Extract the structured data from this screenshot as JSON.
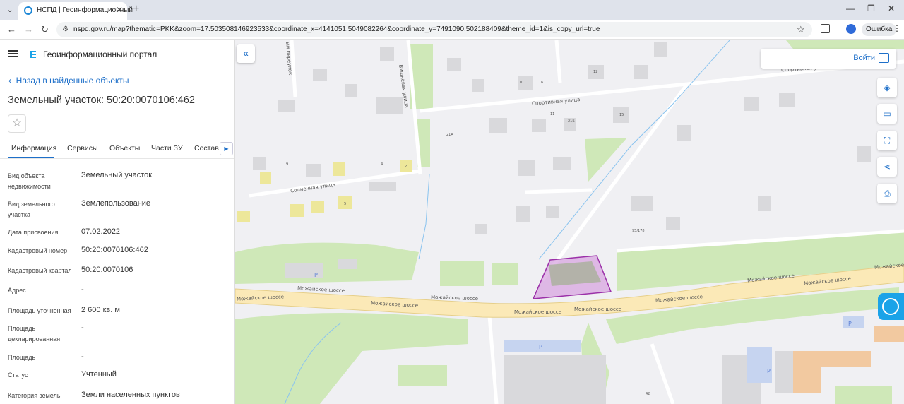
{
  "browser": {
    "tab_title": "НСПД | Геоинформационный",
    "url": "nspd.gov.ru/map?thematic=PKK&zoom=17.503508146923533&coordinate_x=4141051.5049082264&coordinate_y=7491090.502188409&theme_id=1&is_copy_url=true",
    "profile_chip": "Ошибка"
  },
  "panel": {
    "portal_title": "Геоинформационный портал",
    "back_link": "Назад в найденные объекты",
    "object_title": "Земельный участок: 50:20:0070106:462",
    "tabs": [
      "Информация",
      "Сервисы",
      "Объекты",
      "Части ЗУ",
      "Состав"
    ],
    "properties": [
      {
        "label": "Вид объекта недвижимости",
        "value": "Земельный участок"
      },
      {
        "label": "Вид земельного участка",
        "value": "Землепользование"
      },
      {
        "label": "Дата присвоения",
        "value": "07.02.2022"
      },
      {
        "label": "Кадастровый номер",
        "value": "50:20:0070106:462"
      },
      {
        "label": "Кадастровый квартал",
        "value": "50:20:0070106"
      },
      {
        "label": "Адрес",
        "value": "-"
      },
      {
        "label": "Площадь уточненная",
        "value": "2 600 кв. м"
      },
      {
        "label": "Площадь декларированная",
        "value": "-"
      },
      {
        "label": "Площадь",
        "value": "-"
      },
      {
        "label": "Статус",
        "value": "Учтенный"
      },
      {
        "label": "Категория земель",
        "value": "Земли населенных пунктов"
      }
    ]
  },
  "map": {
    "login_label": "Войти",
    "street_labels": {
      "sportivnaya": "Спортивная улица",
      "sportivnaya2": "Спортивная улица",
      "solnechnaya": "Солнечная улица",
      "vishnevaya": "Вишнёвая улица",
      "pereulok": "ый переулок",
      "mozhaiskoe": "Можайское шоссе"
    },
    "house_numbers": [
      "10",
      "16",
      "12",
      "11",
      "21А",
      "21Б",
      "15",
      "9",
      "4",
      "2",
      "5",
      "95/178",
      "42"
    ],
    "parking_label": "P",
    "colors": {
      "road": "#fbe9b7",
      "green": "#cfe8b8",
      "building": "#d9d9dc",
      "parcel": "#9b30a8",
      "accent": "#1d6fc9"
    }
  }
}
